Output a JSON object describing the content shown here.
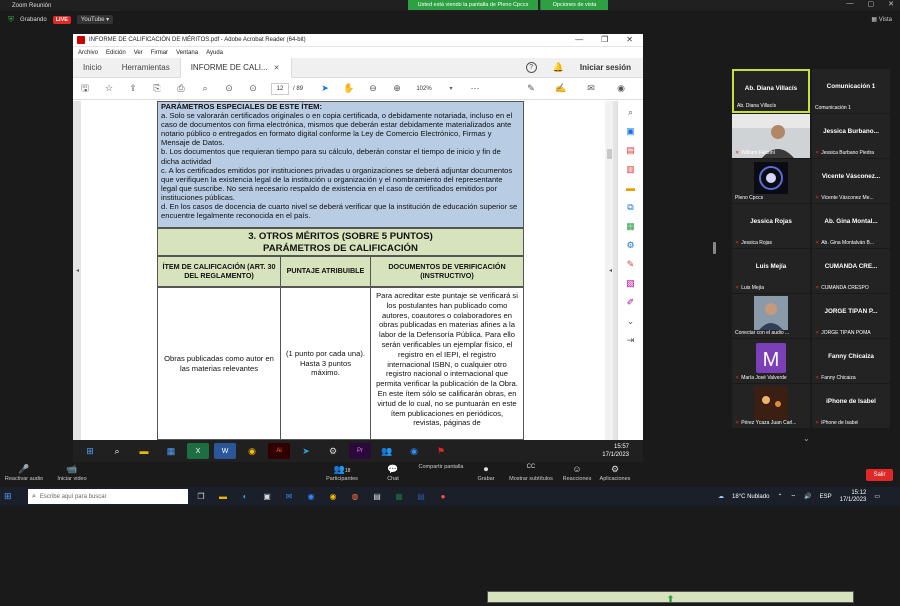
{
  "zoom": {
    "window_title": "Zoom Reunión",
    "share_banner": "Usted está viendo la pantalla de Pleno Cpccs",
    "share_options": "Opciones de vista",
    "recording": "Grabando",
    "live": "LIVE",
    "youtube": "YouTube ▾",
    "view": "Vista",
    "toolbar": [
      {
        "label": "Reactivar audio",
        "icon": "🎤"
      },
      {
        "label": "Iniciar video",
        "icon": "📹"
      },
      {
        "label": "Participantes",
        "icon": "👥",
        "count": "18"
      },
      {
        "label": "Chat",
        "icon": "💬"
      },
      {
        "label": "Compartir pantalla",
        "icon": "⬆"
      },
      {
        "label": "Grabar",
        "icon": "⏺"
      },
      {
        "label": "Mostrar subtítulos",
        "icon": "CC"
      },
      {
        "label": "Reacciones",
        "icon": "☺"
      },
      {
        "label": "Aplicaciones",
        "icon": "⚙"
      }
    ],
    "leave": "Salir"
  },
  "acrobat": {
    "title": "INFORME DE CALIFICACIÓN DE MÉRITOS.pdf - Adobe Acrobat Reader (64-bit)",
    "menu": [
      "Archivo",
      "Edición",
      "Ver",
      "Firmar",
      "Ventana",
      "Ayuda"
    ],
    "tabs": [
      "Inicio",
      "Herramientas",
      "INFORME DE CALI..."
    ],
    "login": "Iniciar sesión",
    "page_current": "12",
    "page_total": "/ 89",
    "zoom_level": "102%"
  },
  "pdf": {
    "section_header": "PARÁMETROS ESPECIALES DE ESTE ÍTEM:",
    "paragraphs": [
      "a. Solo se valorarán certificados originales o en copia certificada, o debidamente notariada, incluso en el caso de documentos con firma electrónica, mismos que deberán estar debidamente materializados ante notario público o entregados en formato digital conforme la Ley de Comercio Electrónico, Firmas y Mensaje de Datos.",
      "b. Los documentos que requieran tiempo para su cálculo, deberán constar el tiempo de inicio y fin de dicha actividad",
      "c. A los certificados emitidos por instituciones privadas u organizaciones se deberá adjuntar documentos que verifiquen la existencia legal de la institución u organización y el nombramiento del representante legal que suscribe. No será necesario respaldo de existencia en el caso de certificados emitidos por instituciones públicas.",
      "d. En los casos de docencia de cuarto nivel se deberá verificar que la institución de educación superior se encuentre legalmente reconocida en el país."
    ],
    "section_title_1": "3. OTROS MÉRITOS (SOBRE 5 PUNTOS)",
    "section_title_2": "PARÁMETROS DE CALIFICACIÓN",
    "columns": [
      "ÍTEM DE CALIFICACIÓN (ART. 30 DEL REGLAMENTO)",
      "PUNTAJE ATRIBUIBLE",
      "DOCUMENTOS DE VERIFICACIÓN (INSTRUCTIVO)"
    ],
    "row": {
      "item": "Obras publicadas como autor en las materias relevantes",
      "points": "(1 punto por cada una). Hasta 3 puntos máximo.",
      "docs": "Para acreditar este puntaje se verificará si los postulantes han publicado como autores, coautores o colaboradores en obras publicadas en materias afines a la labor de la Defensoría Pública. Para ello serán verificables un ejemplar físico, el registro en el IEPI, el registro internacional ISBN, o cualquier otro registro nacional o internacional que permita verificar la publicación de la Obra. En este ítem sólo se calificarán obras, en virtud de lo cual, no se puntuarán en este ítem publicaciones en periódicos, revistas, páginas de"
    }
  },
  "shared_taskbar": {
    "time": "15:57",
    "date": "17/1/2023"
  },
  "participants": [
    {
      "name": "Ab. Diana Villacís",
      "label": "Ab. Diana Villacís",
      "active": true,
      "muted": false
    },
    {
      "name": "Comunicación 1",
      "label": "Comunicación 1",
      "muted": false
    },
    {
      "name": "",
      "label": "William Falconí",
      "muted": true,
      "photo": "person"
    },
    {
      "name": "Jessica Burbano...",
      "label": "Jessica Burbano Piedra",
      "muted": true
    },
    {
      "name": "",
      "label": "Pleno Cpccs",
      "muted": false,
      "photo": "logo"
    },
    {
      "name": "Vicente Vásconez...",
      "label": "Vicente Vásconez Me...",
      "muted": true
    },
    {
      "name": "Jessica Rojas",
      "label": "Jessica Rojas",
      "muted": true
    },
    {
      "name": "Ab. Gina Montal...",
      "label": "Ab. Gina Montalván B...",
      "muted": true
    },
    {
      "name": "Luis Mejía",
      "label": "Luis Mejía",
      "muted": true
    },
    {
      "name": "CUMANDA CRE...",
      "label": "CUMANDA CRESPO",
      "muted": true
    },
    {
      "name": "",
      "label": "Conectar con el audio ...",
      "muted": false,
      "photo": "person2"
    },
    {
      "name": "JORGE TIPÁN P...",
      "label": "JORGE TIPÁN POMA",
      "muted": true
    },
    {
      "name": "",
      "label": "María José Valverde",
      "muted": true,
      "photo": "avatar-m"
    },
    {
      "name": "Fanny Chicaiza",
      "label": "Fanny Chicaiza",
      "muted": true
    },
    {
      "name": "",
      "label": "Pérez Ycaza Juan Carl...",
      "muted": true,
      "photo": "dark"
    },
    {
      "name": "iPhone de Isabel",
      "label": "iPhone de Isabel",
      "muted": true
    }
  ],
  "host_taskbar": {
    "search_placeholder": "Escribe aquí para buscar",
    "weather": "18°C Nublado",
    "lang": "ESP",
    "time": "15:12",
    "date": "17/1/2023"
  },
  "colors": {
    "blue_cell": "#b8cce4",
    "green_cell": "#d6e3bc",
    "zoom_green": "#2ea043",
    "leave_red": "#e02828",
    "active_border": "#c7e03a"
  }
}
